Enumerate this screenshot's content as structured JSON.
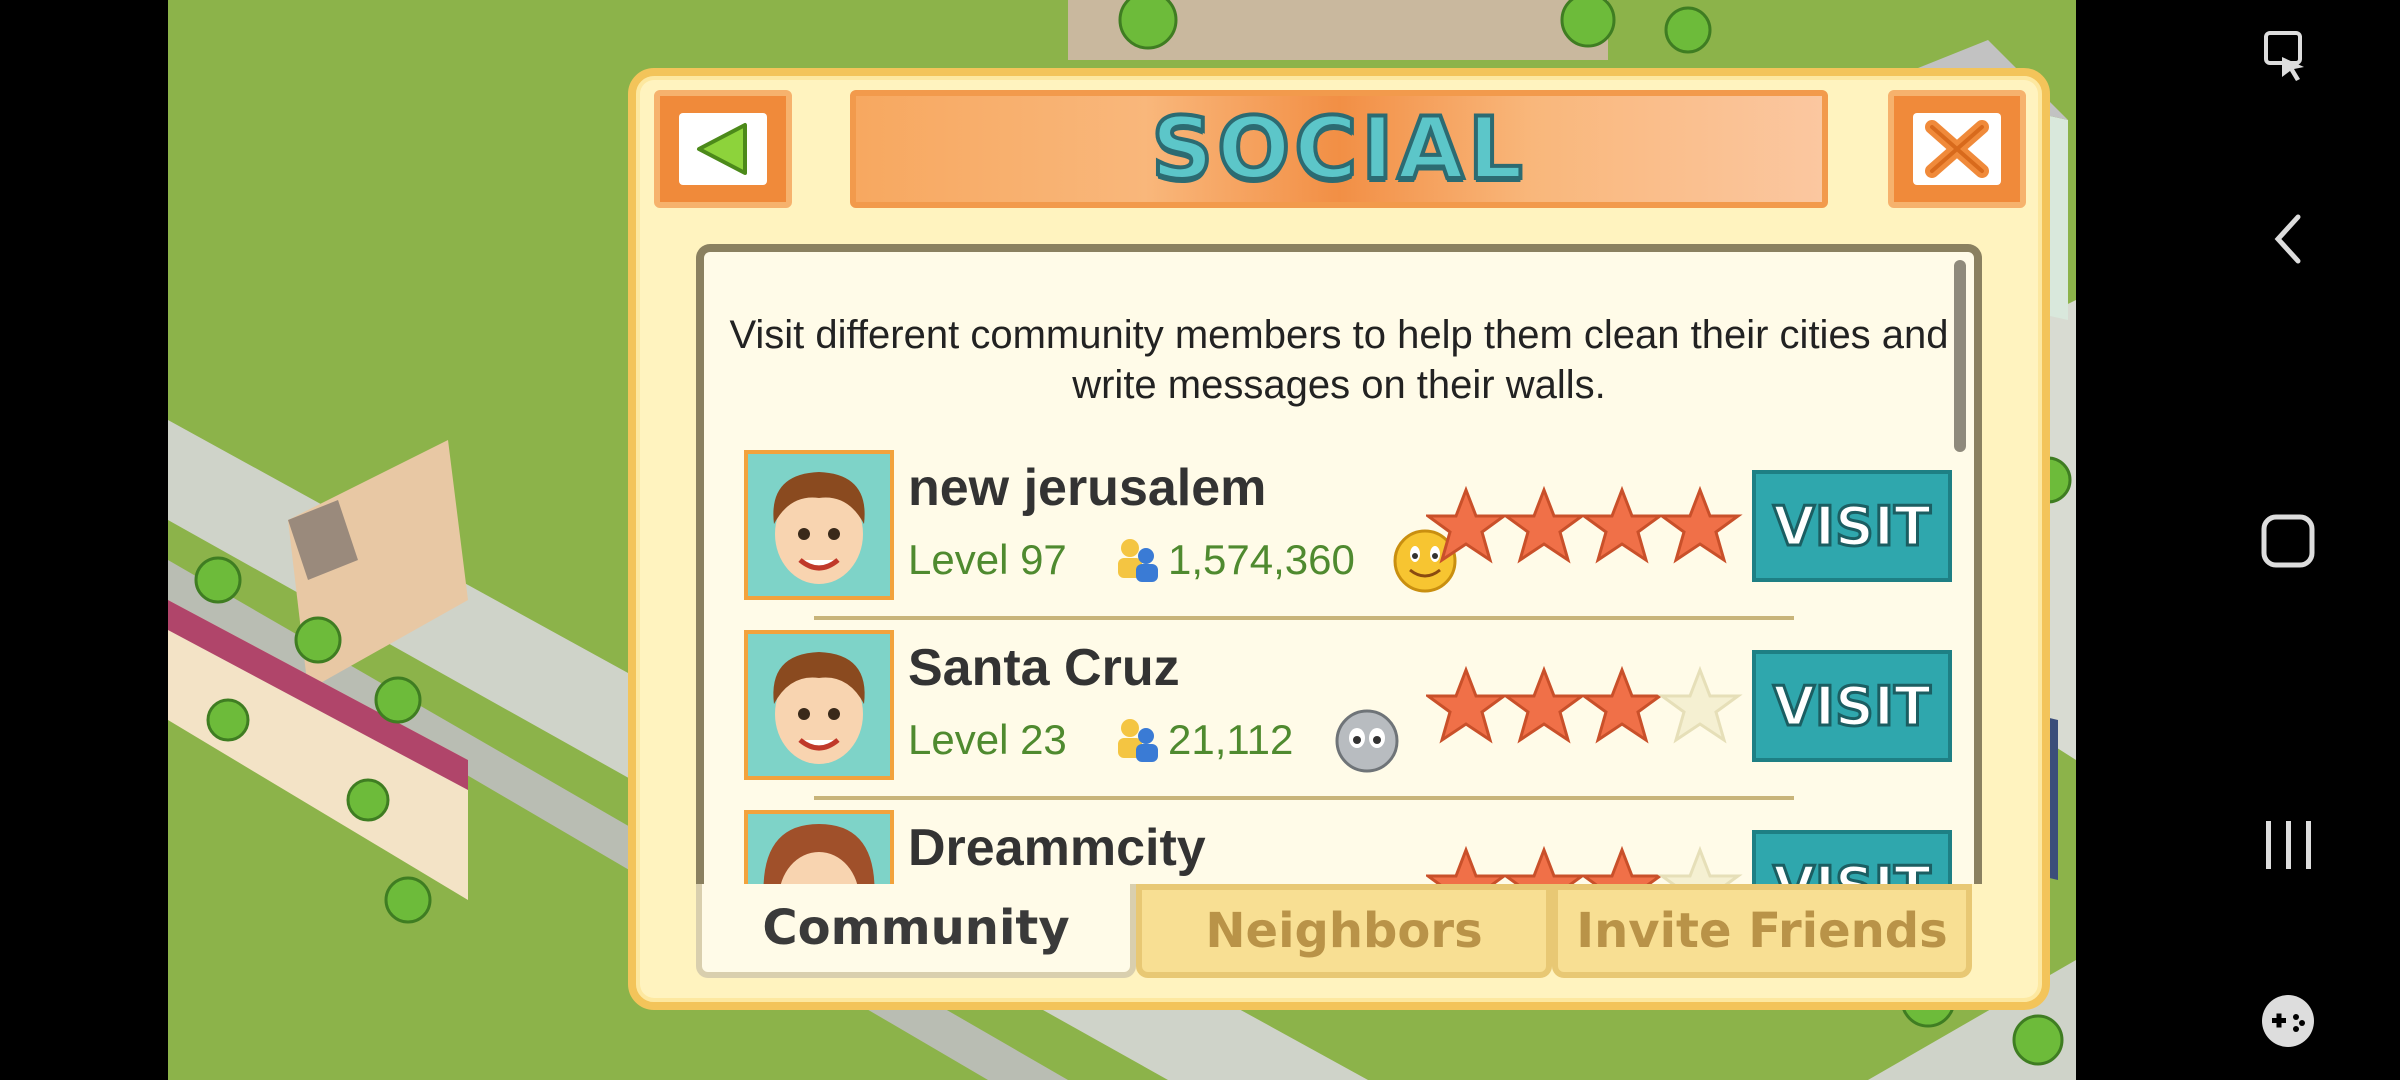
{
  "panel": {
    "title": "SOCIAL",
    "back_button": "back-arrow",
    "close_button": "close-x",
    "description": "Visit different community members to help them clean their cities and write messages on their walls."
  },
  "players": [
    {
      "name": "new jerusalem",
      "level": "Level 97",
      "population": "1,574,360",
      "mood": "happy",
      "stars": 4
    },
    {
      "name": "Santa Cruz",
      "level": "Level 23",
      "population": "21,112",
      "mood": "worried",
      "stars": 3
    },
    {
      "name": "Dreammcity",
      "level": "",
      "population": "",
      "mood": "",
      "stars": 3
    }
  ],
  "visit_label": "VISIT",
  "tabs": [
    {
      "label": "Community",
      "active": true
    },
    {
      "label": "Neighbors",
      "active": false
    },
    {
      "label": "Invite Friends",
      "active": false
    }
  ],
  "colors": {
    "accent_teal": "#2fa7ad",
    "panel_bg": "#fff3bf",
    "panel_border": "#f3c45a",
    "header_orange": "#f08a3a"
  },
  "system_bar": {
    "icons": [
      "screenshot-icon",
      "back-icon",
      "home-icon",
      "recents-icon",
      "game-tools-icon"
    ]
  }
}
